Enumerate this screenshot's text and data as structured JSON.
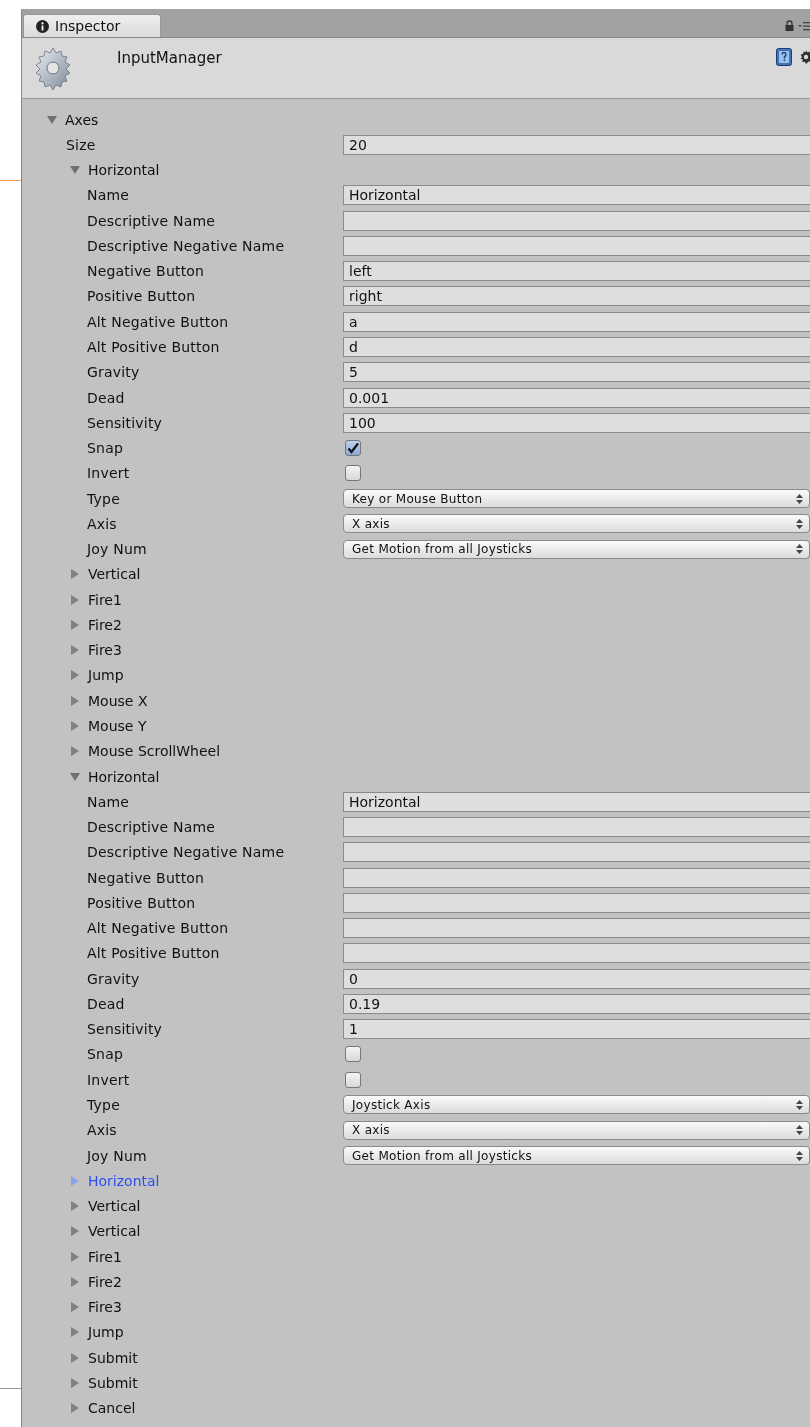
{
  "tab": {
    "label": "Inspector",
    "selected": true
  },
  "header": {
    "title": "InputManager"
  },
  "tree": {
    "label": "Axes",
    "kind": "group",
    "expanded": true,
    "selected": false,
    "children": [
      {
        "label": "Size",
        "kind": "text",
        "value": "20"
      },
      {
        "label": "Horizontal",
        "kind": "group",
        "expanded": true,
        "selected": false,
        "children": [
          {
            "label": "Name",
            "kind": "text",
            "value": "Horizontal"
          },
          {
            "label": "Descriptive Name",
            "kind": "text"
          },
          {
            "label": "Descriptive Negative Name",
            "kind": "text"
          },
          {
            "label": "Negative Button",
            "kind": "text",
            "value": "left"
          },
          {
            "label": "Positive Button",
            "kind": "text",
            "value": "right"
          },
          {
            "label": "Alt Negative Button",
            "kind": "text",
            "value": "a"
          },
          {
            "label": "Alt Positive Button",
            "kind": "text",
            "value": "d"
          },
          {
            "label": "Gravity",
            "kind": "text",
            "value": "5"
          },
          {
            "label": "Dead",
            "kind": "text",
            "value": "0.001"
          },
          {
            "label": "Sensitivity",
            "kind": "text",
            "value": "100"
          },
          {
            "label": "Snap",
            "kind": "checkbox",
            "checked": true
          },
          {
            "label": "Invert",
            "kind": "checkbox",
            "checked": false
          },
          {
            "label": "Type",
            "kind": "dropdown",
            "value": "Key or Mouse Button"
          },
          {
            "label": "Axis",
            "kind": "dropdown",
            "value": "X axis"
          },
          {
            "label": "Joy Num",
            "kind": "dropdown",
            "value": "Get Motion from all Joysticks"
          }
        ]
      },
      {
        "label": "Vertical",
        "kind": "group",
        "expanded": false,
        "selected": false
      },
      {
        "label": "Fire1",
        "kind": "group",
        "expanded": false,
        "selected": false
      },
      {
        "label": "Fire2",
        "kind": "group",
        "expanded": false,
        "selected": false
      },
      {
        "label": "Fire3",
        "kind": "group",
        "expanded": false,
        "selected": false
      },
      {
        "label": "Jump",
        "kind": "group",
        "expanded": false,
        "selected": false
      },
      {
        "label": "Mouse X",
        "kind": "group",
        "expanded": false,
        "selected": false
      },
      {
        "label": "Mouse Y",
        "kind": "group",
        "expanded": false,
        "selected": false
      },
      {
        "label": "Mouse ScrollWheel",
        "kind": "group",
        "expanded": false,
        "selected": false
      },
      {
        "label": "Horizontal",
        "kind": "group",
        "expanded": true,
        "selected": false,
        "children": [
          {
            "label": "Name",
            "kind": "text",
            "value": "Horizontal"
          },
          {
            "label": "Descriptive Name",
            "kind": "text"
          },
          {
            "label": "Descriptive Negative Name",
            "kind": "text"
          },
          {
            "label": "Negative Button",
            "kind": "text"
          },
          {
            "label": "Positive Button",
            "kind": "text"
          },
          {
            "label": "Alt Negative Button",
            "kind": "text"
          },
          {
            "label": "Alt Positive Button",
            "kind": "text"
          },
          {
            "label": "Gravity",
            "kind": "text",
            "value": "0"
          },
          {
            "label": "Dead",
            "kind": "text",
            "value": "0.19"
          },
          {
            "label": "Sensitivity",
            "kind": "text",
            "value": "1"
          },
          {
            "label": "Snap",
            "kind": "checkbox",
            "checked": false
          },
          {
            "label": "Invert",
            "kind": "checkbox",
            "checked": false
          },
          {
            "label": "Type",
            "kind": "dropdown",
            "value": "Joystick Axis"
          },
          {
            "label": "Axis",
            "kind": "dropdown",
            "value": "X axis"
          },
          {
            "label": "Joy Num",
            "kind": "dropdown",
            "value": "Get Motion from all Joysticks"
          }
        ]
      },
      {
        "label": "Horizontal",
        "kind": "group",
        "expanded": false,
        "selected": true
      },
      {
        "label": "Vertical",
        "kind": "group",
        "expanded": false,
        "selected": false
      },
      {
        "label": "Vertical",
        "kind": "group",
        "expanded": false,
        "selected": false
      },
      {
        "label": "Fire1",
        "kind": "group",
        "expanded": false,
        "selected": false
      },
      {
        "label": "Fire2",
        "kind": "group",
        "expanded": false,
        "selected": false
      },
      {
        "label": "Fire3",
        "kind": "group",
        "expanded": false,
        "selected": false
      },
      {
        "label": "Jump",
        "kind": "group",
        "expanded": false,
        "selected": false
      },
      {
        "label": "Submit",
        "kind": "group",
        "expanded": false,
        "selected": false
      },
      {
        "label": "Submit",
        "kind": "group",
        "expanded": false,
        "selected": false
      },
      {
        "label": "Cancel",
        "kind": "group",
        "expanded": false,
        "selected": false
      }
    ]
  }
}
